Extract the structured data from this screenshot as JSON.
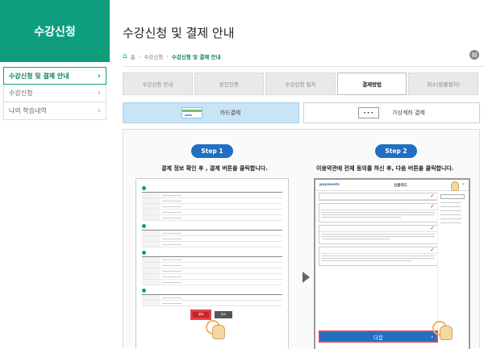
{
  "sidebar": {
    "title": "수강신청",
    "items": [
      {
        "label": "수강신청 및 결제 안내",
        "active": true
      },
      {
        "label": "수강신청",
        "active": false
      },
      {
        "label": "나의 학습내역",
        "active": false
      }
    ],
    "chevron": "›"
  },
  "page": {
    "title": "수강신청 및 결제 안내",
    "breadcrumb": [
      "홈",
      "수강신청",
      "수강신청 및 결제 안내"
    ],
    "print_icon": "printer-icon"
  },
  "tabs": [
    "수강신청 안내",
    "본인인증",
    "수강신청 절차",
    "결제방법",
    "취소(환불절차)"
  ],
  "active_tab": "결제방법",
  "subtabs": {
    "card": "카드결제",
    "vaccount": "가상계좌 결제",
    "vaccount_icon_text": "•••"
  },
  "steps": {
    "step1": {
      "label": "Step 1",
      "desc": "결제 정보 확인 후 , 결제 버튼을 클릭합니다."
    },
    "step2": {
      "label": "Step 2",
      "desc": "이용약관에 전체 동의를 하신 후, 다음 버튼을 클릭합니다."
    }
  },
  "mockup1": {
    "pay_button": "결제",
    "cancel_button": "취소"
  },
  "mockup2": {
    "logo": "payments",
    "title": "신용카드",
    "next_button": "다음"
  }
}
